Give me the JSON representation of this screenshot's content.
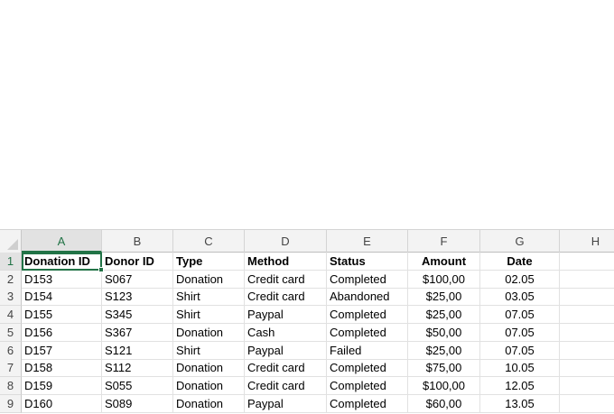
{
  "sheet": {
    "columns": [
      "A",
      "B",
      "C",
      "D",
      "E",
      "F",
      "G",
      "H"
    ],
    "rows": [
      "1",
      "2",
      "3",
      "4",
      "5",
      "6",
      "7",
      "8",
      "9"
    ],
    "active_cell": "A1",
    "accent_color": "#217346",
    "cells": [
      [
        "Donation ID",
        "Donor ID",
        "Type",
        "Method",
        "Status",
        "Amount",
        "Date",
        ""
      ],
      [
        "D153",
        "S067",
        "Donation",
        "Credit card",
        "Completed",
        "$100,00",
        "02.05",
        ""
      ],
      [
        "D154",
        "S123",
        "Shirt",
        "Credit card",
        "Abandoned",
        "$25,00",
        "03.05",
        ""
      ],
      [
        "D155",
        "S345",
        "Shirt",
        "Paypal",
        "Completed",
        "$25,00",
        "07.05",
        ""
      ],
      [
        "D156",
        "S367",
        "Donation",
        "Cash",
        "Completed",
        "$50,00",
        "07.05",
        ""
      ],
      [
        "D157",
        "S121",
        "Shirt",
        "Paypal",
        "Failed",
        "$25,00",
        "07.05",
        ""
      ],
      [
        "D158",
        "S112",
        "Donation",
        "Credit card",
        "Completed",
        "$75,00",
        "10.05",
        ""
      ],
      [
        "D159",
        "S055",
        "Donation",
        "Credit card",
        "Completed",
        "$100,00",
        "12.05",
        ""
      ],
      [
        "D160",
        "S089",
        "Donation",
        "Paypal",
        "Completed",
        "$60,00",
        "13.05",
        ""
      ]
    ]
  }
}
